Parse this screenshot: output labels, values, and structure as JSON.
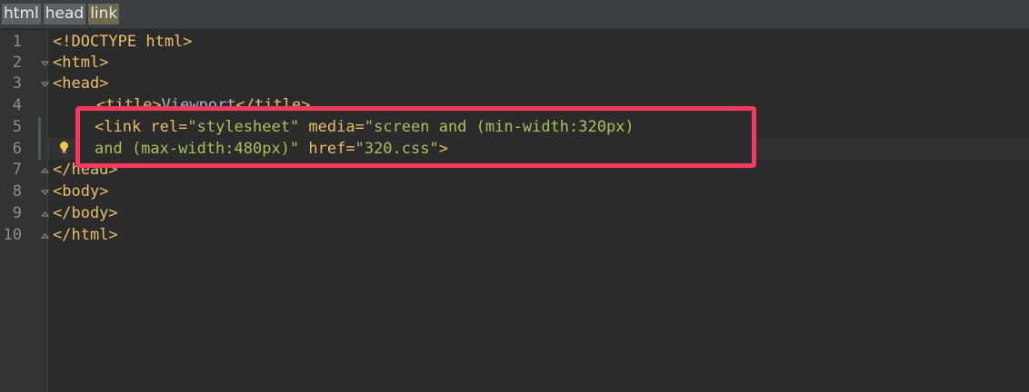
{
  "breadcrumb": [
    {
      "label": "html"
    },
    {
      "label": "head"
    },
    {
      "label": "link"
    }
  ],
  "line_numbers": [
    "1",
    "2",
    "3",
    "4",
    "5",
    "6",
    "7",
    "8",
    "9",
    "10"
  ],
  "code": {
    "l1": "<!DOCTYPE html>",
    "l2": "<html>",
    "l3": "<head>",
    "l4_tag_open": "<title>",
    "l4_text": "Viewport",
    "l4_tag_close": "</title>",
    "l5_tag": "<link",
    "l5_attr1": " rel=",
    "l5_val1": "\"stylesheet\"",
    "l5_attr2": " media=",
    "l5_val2": "\"screen and (min-width:320px)",
    "l6_val": "and (max-width:480px)\"",
    "l6_attr": " href=",
    "l6_val2": "\"320.css\"",
    "l6_tag": ">",
    "l7": "</head>",
    "l8": "<body>",
    "l9": "</body>",
    "l10": "</html>"
  },
  "colors": {
    "highlight_border": "#f7385f",
    "tag": "#e8bf6a",
    "value": "#a5c25c",
    "background": "#2b2b2b"
  },
  "icons": {
    "intention": "lightbulb-icon",
    "fold": "fold-arrow-icon"
  }
}
